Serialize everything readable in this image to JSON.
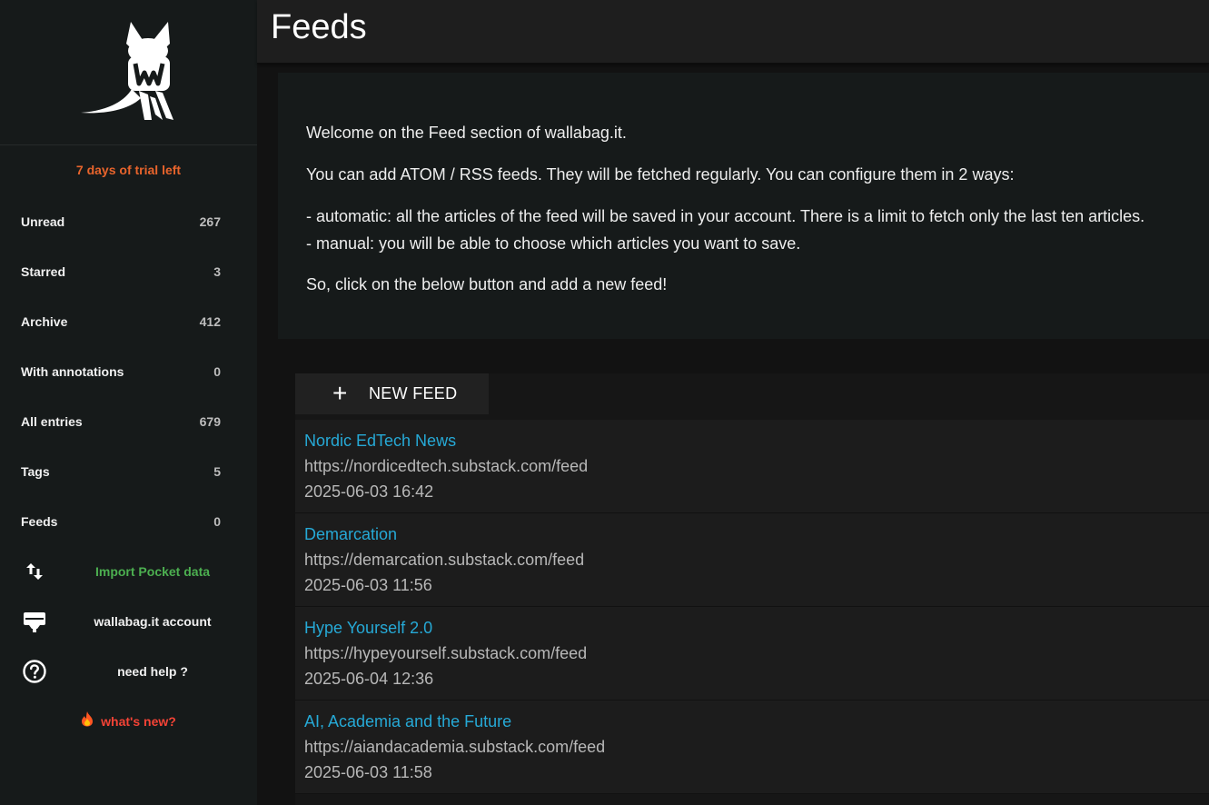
{
  "header": {
    "title": "Feeds"
  },
  "sidebar": {
    "trial": "7 days of trial left",
    "items": [
      {
        "label": "Unread",
        "count": "267"
      },
      {
        "label": "Starred",
        "count": "3"
      },
      {
        "label": "Archive",
        "count": "412"
      },
      {
        "label": "With annotations",
        "count": "0"
      },
      {
        "label": "All entries",
        "count": "679"
      },
      {
        "label": "Tags",
        "count": "5"
      },
      {
        "label": "Feeds",
        "count": "0"
      }
    ],
    "import_label": "Import Pocket data",
    "account_label": "wallabag.it account",
    "help_label": "need help ?",
    "whatsnew_label": "what's new?",
    "icons": {
      "import": "swap-vertical-icon",
      "account": "card-icon",
      "help": "help-circle-icon",
      "whatsnew": "fire-icon"
    }
  },
  "intro": {
    "p1": "Welcome on the Feed section of wallabag.it.",
    "p2": "You can add ATOM / RSS feeds. They will be fetched regularly. You can configure them in 2 ways:",
    "p3a": "- automatic: all the articles of the feed will be saved in your account. There is a limit to fetch only the last ten articles.",
    "p3b": "- manual: you will be able to choose which articles you want to save.",
    "p4": "So, click on the below button and add a new feed!"
  },
  "new_feed": {
    "plus": "+",
    "label": "NEW FEED"
  },
  "feeds": [
    {
      "title": "Nordic EdTech News",
      "url": "https://nordicedtech.substack.com/feed",
      "date": "2025-06-03 16:42"
    },
    {
      "title": "Demarcation",
      "url": "https://demarcation.substack.com/feed",
      "date": "2025-06-03 11:56"
    },
    {
      "title": "Hype Yourself 2.0",
      "url": "https://hypeyourself.substack.com/feed",
      "date": "2025-06-04 12:36"
    },
    {
      "title": "AI, Academia and the Future",
      "url": "https://aiandacademia.substack.com/feed",
      "date": "2025-06-03 11:58"
    }
  ],
  "colors": {
    "link": "#26a9d6",
    "trial": "#e8642c",
    "import": "#4caf50",
    "whatsnew": "#f44336"
  }
}
